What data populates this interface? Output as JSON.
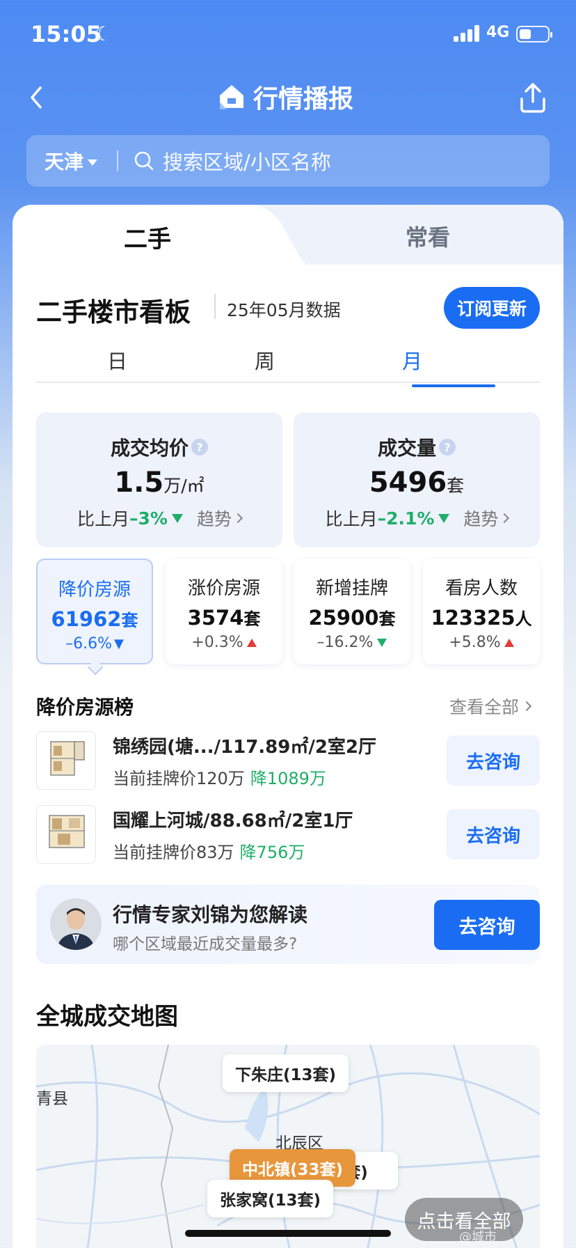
{
  "status_bar": {
    "time": "15:05",
    "network": "4G"
  },
  "nav": {
    "title": "行情播报"
  },
  "search": {
    "city": "天津",
    "placeholder": "搜索区域/小区名称"
  },
  "main_tabs": {
    "active": "二手",
    "other": "常看"
  },
  "board": {
    "title": "二手楼市看板",
    "date": "25年05月数据",
    "subscribe_label": "订阅更新",
    "periods": [
      "日",
      "周",
      "月"
    ],
    "active_period": "月"
  },
  "big_stats": [
    {
      "label": "成交均价",
      "value": "1.5",
      "unit": "万/㎡",
      "compare_label": "比上月",
      "change": "–3%",
      "trend_label": "趋势"
    },
    {
      "label": "成交量",
      "value": "5496",
      "unit": "套",
      "compare_label": "比上月",
      "change": "–2.1%",
      "trend_label": "趋势"
    }
  ],
  "small_stats": [
    {
      "label": "降价房源",
      "value": "61962",
      "unit": "套",
      "change": "–6.6%",
      "direction": "down"
    },
    {
      "label": "涨价房源",
      "value": "3574",
      "unit": "套",
      "change": "+0.3%",
      "direction": "up"
    },
    {
      "label": "新增挂牌",
      "value": "25900",
      "unit": "套",
      "change": "–16.2%",
      "direction": "down"
    },
    {
      "label": "看房人数",
      "value": "123325",
      "unit": "人",
      "change": "+5.8%",
      "direction": "up"
    }
  ],
  "price_drop_list": {
    "title": "降价房源榜",
    "more_label": "查看全部",
    "items": [
      {
        "title": "锦绣园(塘.../117.89㎡/2室2厅",
        "price": "当前挂牌价120万",
        "drop": "降1089万",
        "action": "去咨询"
      },
      {
        "title": "国耀上河城/88.68㎡/2室1厅",
        "price": "当前挂牌价83万",
        "drop": "降756万",
        "action": "去咨询"
      }
    ]
  },
  "expert": {
    "title": "行情专家刘锦为您解读",
    "subtitle": "哪个区域最近成交量最多?",
    "action": "去咨询"
  },
  "map": {
    "title": "全城成交地图",
    "labels": [
      "下朱庄(13套)",
      "北辰区",
      "中北镇(33套)",
      "张家窝(13套)",
      "套)",
      "青县"
    ],
    "see_all_label": "点击看全部"
  },
  "watermark": "@城市",
  "colors": {
    "accent": "#1a6df2",
    "down": "#1fae69",
    "up": "#e23a3a",
    "pin_highlight": "#e8963c"
  }
}
